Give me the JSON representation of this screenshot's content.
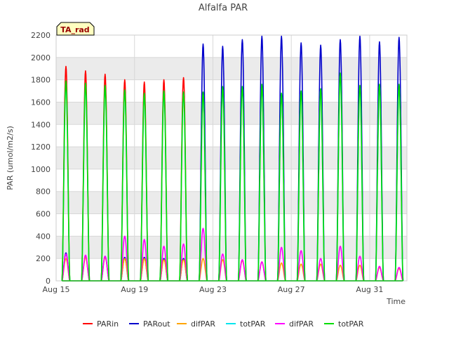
{
  "chart_data": {
    "type": "line",
    "title": "Alfalfa PAR",
    "xlabel": "Time",
    "ylabel": "PAR (umol/m2/s)",
    "ylim": [
      0,
      2200
    ],
    "xlim": [
      15,
      32.9
    ],
    "yticks": [
      0,
      200,
      400,
      600,
      800,
      1000,
      1200,
      1400,
      1600,
      1800,
      2000,
      2200
    ],
    "xticks": [
      {
        "day": 15,
        "label": "Aug 15"
      },
      {
        "day": 19,
        "label": "Aug 19"
      },
      {
        "day": 23,
        "label": "Aug 23"
      },
      {
        "day": 27,
        "label": "Aug 27"
      },
      {
        "day": 31,
        "label": "Aug 31"
      }
    ],
    "grid": true,
    "badge": "TA_rad",
    "legend_position": "bottom",
    "colors": {
      "PARin": "#ff0000",
      "PARout": "#0000cc",
      "difPAR_orange": "#ffa500",
      "totPAR_cyan": "#00e5ee",
      "difPAR_magenta": "#ff00ff",
      "totPAR_green": "#00dd00",
      "band": "#ebebeb",
      "badge_fill": "#ffffc0",
      "badge_text": "#990000"
    },
    "series": [
      {
        "name": "PARin",
        "color": "#ff0000",
        "days": [
          15,
          16,
          17,
          18,
          19,
          20,
          21
        ],
        "peaks": [
          1920,
          1880,
          1850,
          1800,
          1780,
          1800,
          1820
        ]
      },
      {
        "name": "PARout",
        "color": "#0000cc",
        "days": [
          15,
          16,
          17,
          18,
          19,
          20,
          21,
          22,
          23,
          24,
          25,
          26,
          27,
          28,
          29,
          30,
          31,
          32
        ],
        "peaks": [
          250,
          220,
          220,
          210,
          210,
          200,
          200,
          2120,
          2100,
          2160,
          2190,
          2190,
          2130,
          2110,
          2160,
          2190,
          2140,
          2180
        ]
      },
      {
        "name": "difPAR",
        "color": "#ffa500",
        "days": [
          15,
          16,
          17,
          18,
          19,
          20,
          21,
          22,
          23,
          24,
          25,
          26,
          27,
          28,
          29,
          30,
          31,
          32
        ],
        "peaks": [
          200,
          210,
          210,
          200,
          200,
          190,
          190,
          200,
          190,
          180,
          170,
          160,
          150,
          150,
          140,
          140,
          120,
          110
        ]
      },
      {
        "name": "totPAR",
        "color": "#00e5ee",
        "days": [
          15,
          16,
          17,
          18,
          19,
          20,
          21,
          22,
          23,
          24,
          25,
          26,
          27,
          28,
          29,
          30,
          31,
          32
        ],
        "peaks": [
          1780,
          1760,
          1740,
          1700,
          1670,
          1700,
          1690,
          1680,
          1730,
          1740,
          1750,
          1680,
          1700,
          1720,
          1850,
          1740,
          1750,
          1750
        ]
      },
      {
        "name": "difPAR",
        "color": "#ff00ff",
        "days": [
          15,
          16,
          17,
          18,
          19,
          20,
          21,
          22,
          23,
          24,
          25,
          26,
          27,
          28,
          29,
          30,
          31,
          32
        ],
        "peaks": [
          240,
          230,
          220,
          400,
          370,
          310,
          330,
          470,
          240,
          190,
          170,
          300,
          270,
          200,
          310,
          220,
          130,
          120
        ]
      },
      {
        "name": "totPAR",
        "color": "#00dd00",
        "days": [
          15,
          16,
          17,
          18,
          19,
          20,
          21,
          22,
          23,
          24,
          25,
          26,
          27,
          28,
          29,
          30,
          31,
          32
        ],
        "peaks": [
          1790,
          1770,
          1750,
          1710,
          1680,
          1700,
          1690,
          1690,
          1740,
          1740,
          1760,
          1680,
          1700,
          1720,
          1860,
          1750,
          1760,
          1760
        ]
      }
    ]
  }
}
